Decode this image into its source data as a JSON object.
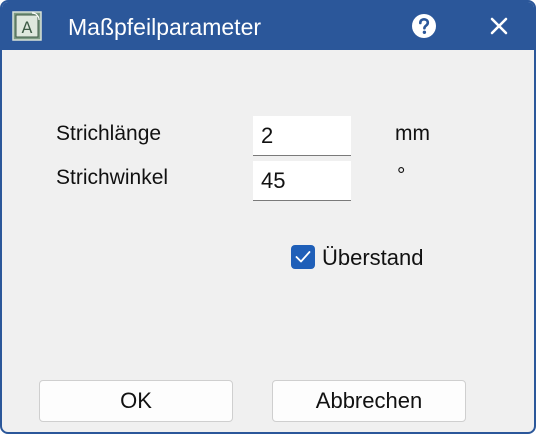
{
  "window": {
    "title": "Maßpfeilparameter",
    "app_icon_letter": "A",
    "help_icon": "question-circle-icon",
    "close_icon": "close-icon",
    "accent_color": "#2b579a"
  },
  "fields": {
    "stroke_length": {
      "label": "Strichlänge",
      "value": "2",
      "unit": "mm"
    },
    "stroke_angle": {
      "label": "Strichwinkel",
      "value": "45",
      "unit": "°"
    }
  },
  "overhang": {
    "label": "Überstand",
    "checked": true,
    "check_color": "#1f5fb8"
  },
  "buttons": {
    "ok": "OK",
    "cancel": "Abbrechen"
  }
}
